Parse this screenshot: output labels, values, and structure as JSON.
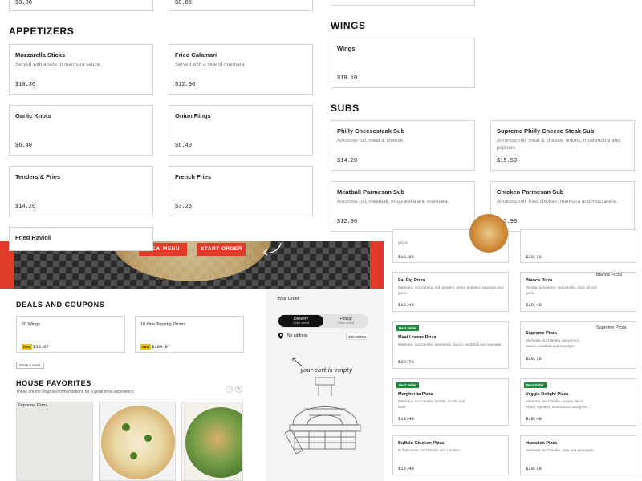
{
  "top_prices": {
    "left": "$3.80",
    "right": "$8.85"
  },
  "appetizers": {
    "title": "APPETIZERS",
    "items": [
      {
        "name": "Mozzarella Sticks",
        "desc": "Served with a side of marinara sauce.",
        "price": "$10.30"
      },
      {
        "name": "Fried Calamari",
        "desc": "Served with a side of marinara.",
        "price": "$12.90"
      },
      {
        "name": "Garlic Knots",
        "desc": "",
        "price": "$6.40"
      },
      {
        "name": "Onion Rings",
        "desc": "",
        "price": "$6.40"
      },
      {
        "name": "Tenders & Fries",
        "desc": "",
        "price": "$14.20"
      },
      {
        "name": "French Fries",
        "desc": "",
        "price": "$3.25"
      },
      {
        "name": "Fried Ravioli",
        "desc": "",
        "price": ""
      }
    ]
  },
  "wings": {
    "title": "WINGS",
    "items": [
      {
        "name": "Wings",
        "desc": "",
        "price": "$18.10"
      }
    ]
  },
  "subs": {
    "title": "SUBS",
    "items": [
      {
        "name": "Philly Cheesesteak Sub",
        "desc": "Amoroso roll, meat & cheese.",
        "price": "$14.20"
      },
      {
        "name": "Supreme Philly Cheese Steak Sub",
        "desc": "Amoroso roll, meat & cheese, onions, mushrooms and peppers.",
        "price": "$15.50"
      },
      {
        "name": "Meatball Parmesan Sub",
        "desc": "Amoroso roll, meatball, mozzarella and marinara.",
        "price": "$12.90"
      },
      {
        "name": "Chicken Parmesan Sub",
        "desc": "Amoroso roll, fried chicken, marinara and mozzarella.",
        "price": "$12.90"
      }
    ]
  },
  "hero": {
    "view_menu": "VIEW MENU",
    "start_order": "START ORDER"
  },
  "deals": {
    "title": "DEALS AND COUPONS",
    "items": [
      {
        "name": "50 Wings",
        "badge": "Deal",
        "price": "$59.67"
      },
      {
        "name": "10 One Topping Pizzas",
        "badge": "Deal",
        "price": "$194.87"
      }
    ],
    "show_more": "Show 6 more"
  },
  "favorites": {
    "title": "HOUSE FAVORITES",
    "subtitle": "These are the shop recommendations for a great meal experience.",
    "first_alt": "Supreme Pizza"
  },
  "order": {
    "title": "Your Order",
    "delivery_label": "Delivery",
    "delivery_sub": "Order ahead",
    "pickup_label": "Pickup",
    "pickup_sub": "Order ahead",
    "address": "No address",
    "add_address": "Add address",
    "empty": "your cart is empty"
  },
  "pizzas": {
    "top_partial_text": "pizza.",
    "top_left_price": "$16.80",
    "top_right_price": "$20.70",
    "items": [
      {
        "name": "Fat Pig Pizza",
        "desc": "Marinara, mozzarella, red peppers, green peppers, sausage and garlic.",
        "price": "$19.40",
        "badge": "",
        "alt": ""
      },
      {
        "name": "Bianca Pizza",
        "desc": "Ricotta, provolone, mozzarella, olive oil and garlic.",
        "price": "$19.40",
        "badge": "",
        "alt": "Bianca Pizza"
      },
      {
        "name": "Meat Lovers Pizza",
        "desc": "Marinara, mozzarella, pepperoni, bacon, meatball and sausage.",
        "price": "$20.70",
        "badge": "Best Seller",
        "alt": ""
      },
      {
        "name": "Supreme Pizza",
        "desc": "Marinara, mozzarella, pepperoni, bacon, meatball and sausage.",
        "price": "$20.70",
        "badge": "",
        "alt": "Supreme Pizza"
      },
      {
        "name": "Margherita Pizza",
        "desc": "Marinara, mozzarella, tomato, ricotta and basil.",
        "price": "$19.40",
        "badge": "Best Seller",
        "alt": ""
      },
      {
        "name": "Veggie Delight Pizza",
        "desc": "Marinara, mozzarella, onions, black olives, spinach, mushrooms and gree...",
        "price": "$19.40",
        "badge": "Best Seller",
        "alt": ""
      },
      {
        "name": "Buffalo Chicken Pizza",
        "desc": "Buffalo base, mozzarella and chicken.",
        "price": "$19.40",
        "badge": "",
        "alt": ""
      },
      {
        "name": "Hawaiian Pizza",
        "desc": "Marinara, mozzarella, ham and pineapple.",
        "price": "$20.70",
        "badge": "",
        "alt": ""
      }
    ]
  },
  "colors": {
    "accent_red": "#e03a2b",
    "best_seller_green": "#1e8a3a",
    "deal_yellow": "#f2c300",
    "dark": "#1a1a1a"
  }
}
